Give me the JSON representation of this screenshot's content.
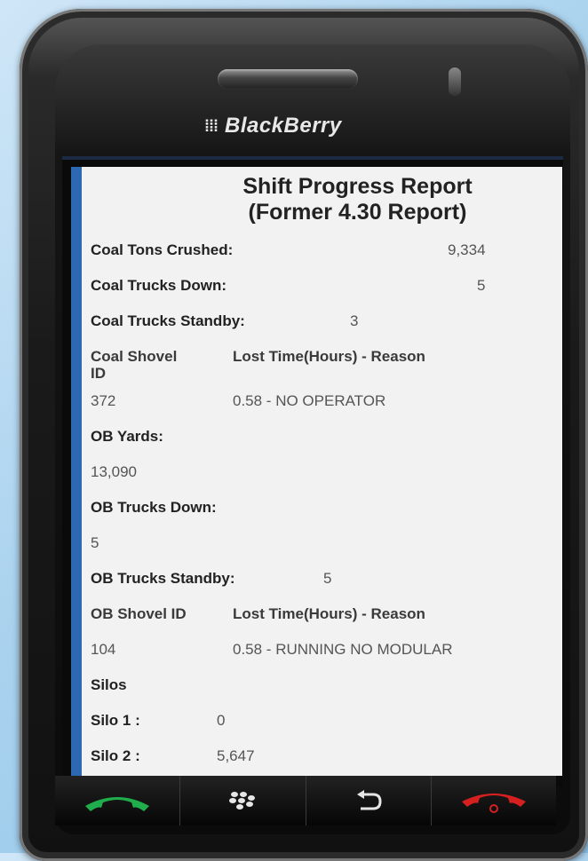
{
  "device": {
    "brand": "BlackBerry",
    "brand_logo": "⁞⁞⁞"
  },
  "report": {
    "title_line1": "Shift Progress Report",
    "title_line2": "(Former 4.30 Report)",
    "coal_tons_label": "Coal Tons Crushed:",
    "coal_tons_value": "9,334",
    "coal_trucks_down_label": "Coal Trucks Down:",
    "coal_trucks_down_value": "5",
    "coal_trucks_standby_label": "Coal Trucks Standby:",
    "coal_trucks_standby_value": "3",
    "coal_table": {
      "col1_header_line1": "Coal Shovel",
      "col1_header_line2": "ID",
      "col2_header": "Lost Time(Hours) - Reason",
      "row_id": "372",
      "row_reason": "0.58 - NO OPERATOR"
    },
    "ob_yards_label": "OB Yards:",
    "ob_yards_value": "13,090",
    "ob_trucks_down_label": "OB Trucks Down:",
    "ob_trucks_down_value": "5",
    "ob_trucks_standby_label": "OB Trucks Standby:",
    "ob_trucks_standby_value": "5",
    "ob_table": {
      "col1_header": "OB Shovel ID",
      "col2_header": "Lost Time(Hours) - Reason",
      "row_id": "104",
      "row_reason": "0.58 - RUNNING NO MODULAR"
    },
    "silos_label": "Silos",
    "silo1_label": "Silo 1 :",
    "silo1_value": "0",
    "silo2_label": "Silo 2 :",
    "silo2_value": "5,647"
  },
  "nav": {
    "call_icon": "green-phone-icon",
    "menu_icon": "blackberry-menu-icon",
    "back_icon": "back-arrow-icon",
    "end_icon": "red-phone-icon",
    "call_color": "#1fae4b",
    "end_color": "#d62020"
  }
}
